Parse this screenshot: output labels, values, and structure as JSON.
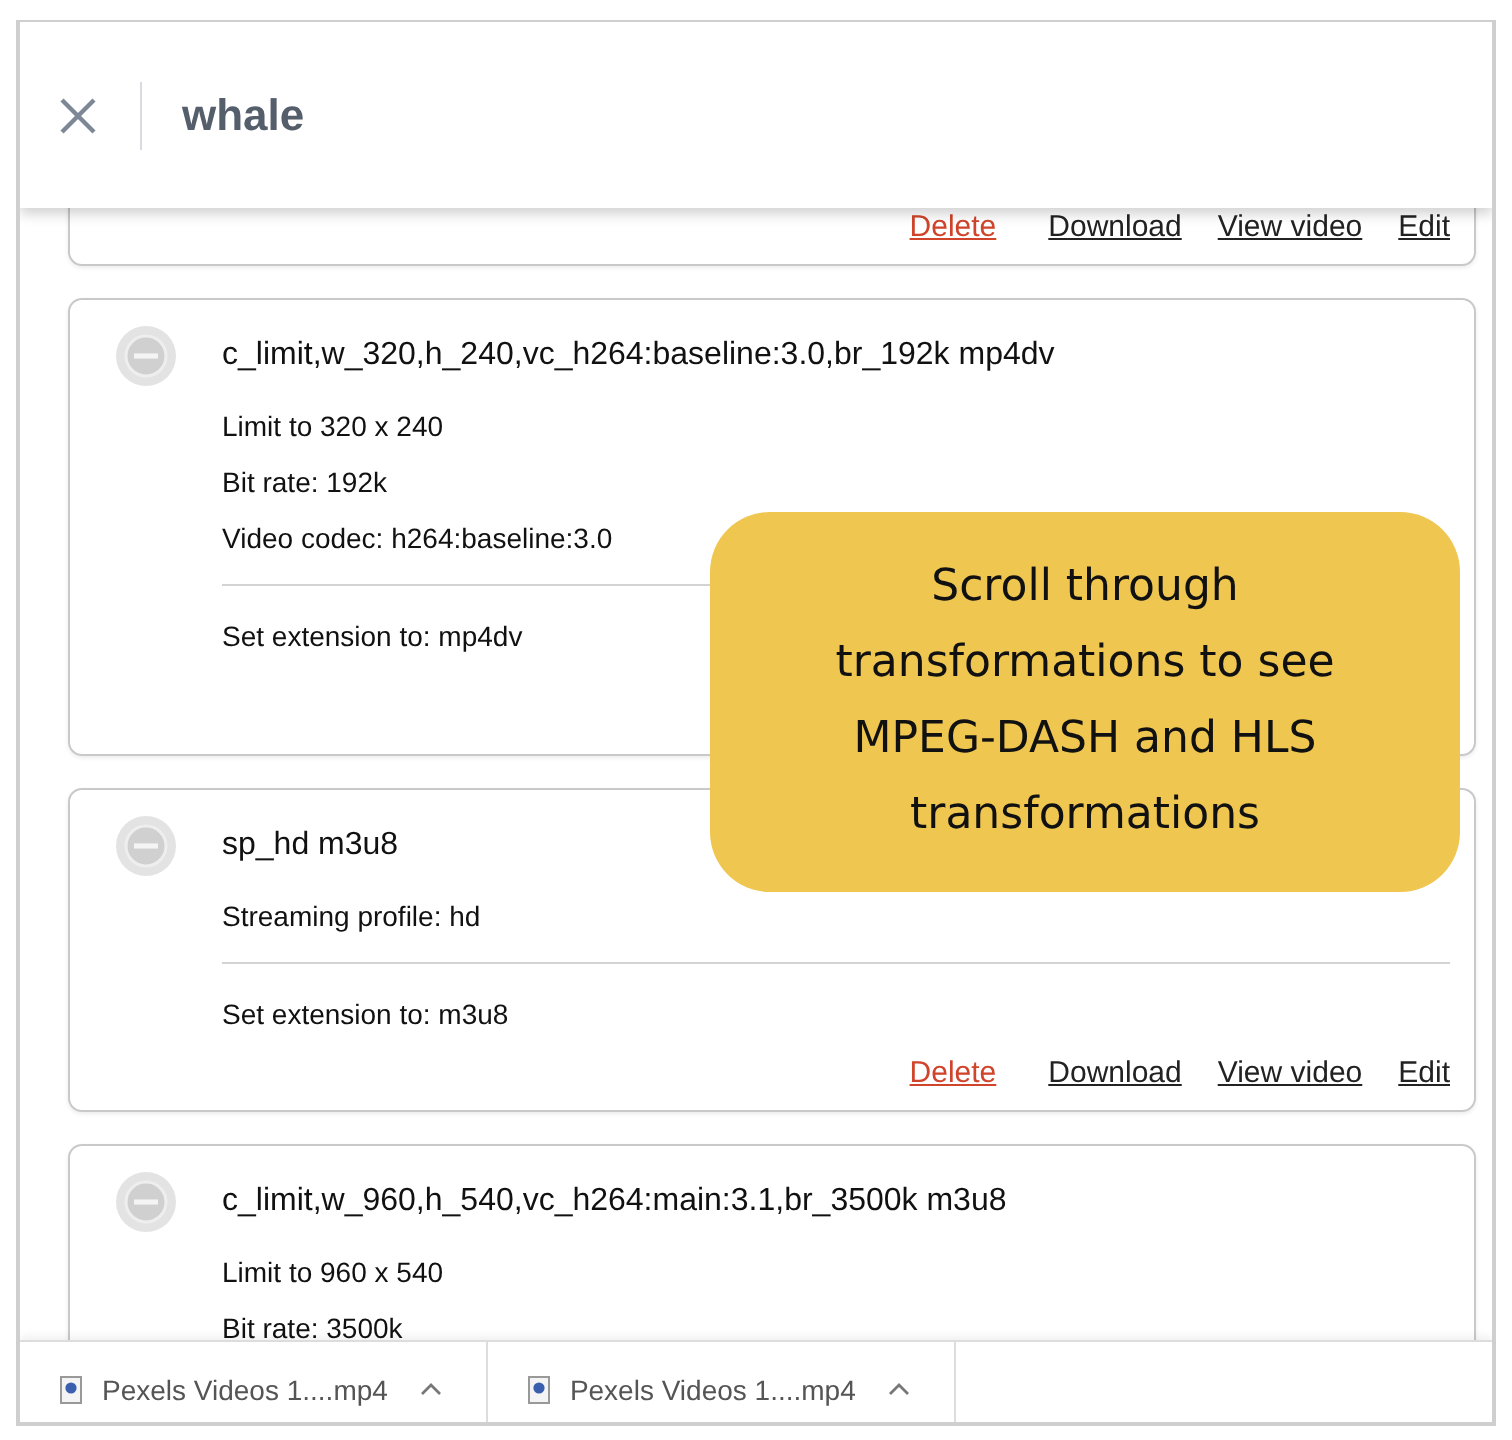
{
  "search": {
    "value": "whale"
  },
  "transformations": [
    {
      "actions": [
        {
          "label": "Delete",
          "kind": "danger"
        },
        {
          "label": "Download",
          "kind": "link"
        },
        {
          "label": "View video",
          "kind": "link"
        },
        {
          "label": "Edit",
          "kind": "link"
        }
      ]
    },
    {
      "title": "c_limit,w_320,h_240,vc_h264:baseline:3.0,br_192k mp4dv",
      "details": [
        "Limit to 320 x 240",
        "Bit rate: 192k",
        "Video codec: h264:baseline:3.0"
      ],
      "extension": "Set extension to: mp4dv"
    },
    {
      "title": "sp_hd m3u8",
      "details": [
        "Streaming profile: hd"
      ],
      "extension": "Set extension to: m3u8",
      "actions": [
        {
          "label": "Delete",
          "kind": "danger"
        },
        {
          "label": "Download",
          "kind": "link"
        },
        {
          "label": "View video",
          "kind": "link"
        },
        {
          "label": "Edit",
          "kind": "link"
        }
      ]
    },
    {
      "title": "c_limit,w_960,h_540,vc_h264:main:3.1,br_3500k m3u8",
      "details": [
        "Limit to 960 x 540",
        "Bit rate: 3500k"
      ]
    }
  ],
  "callout": {
    "text": "Scroll through transformations to see MPEG-DASH and HLS transformations"
  },
  "downloads": [
    {
      "name": "Pexels Videos 1....mp4"
    },
    {
      "name": "Pexels Videos 1....mp4"
    }
  ]
}
